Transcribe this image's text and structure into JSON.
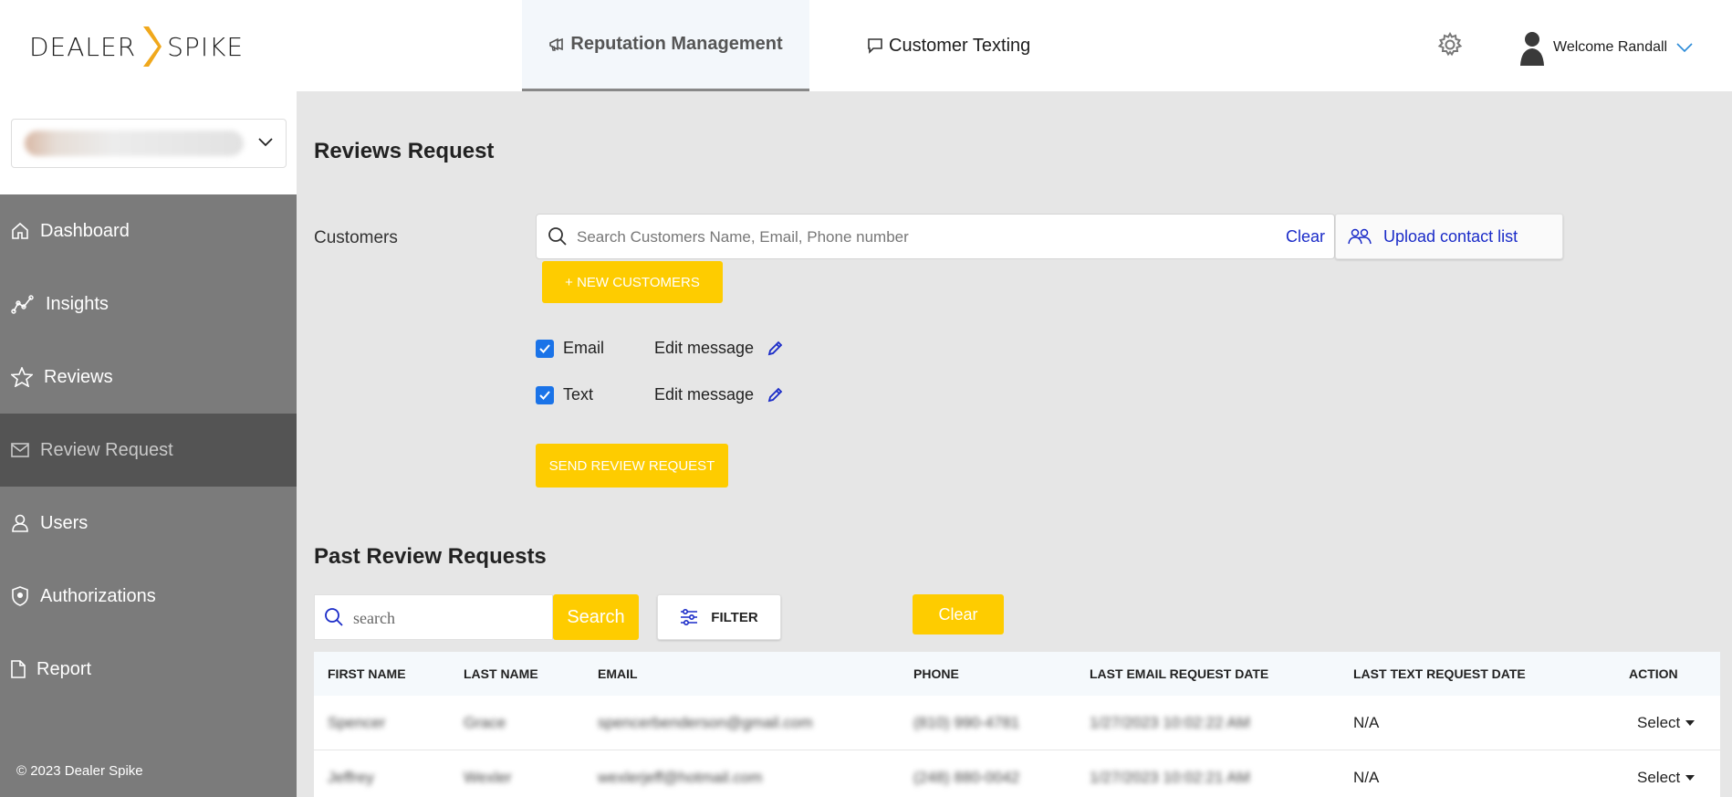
{
  "header": {
    "logo_left": "DEALER",
    "logo_right": "SPIKE",
    "tabs": [
      {
        "label": "Reputation Management",
        "icon": "megaphone-icon",
        "active": true
      },
      {
        "label": "Customer Texting",
        "icon": "chat-bubble-icon",
        "active": false
      }
    ],
    "welcome": "Welcome Randall"
  },
  "sidebar": {
    "items": [
      {
        "label": "Dashboard",
        "icon": "home-icon"
      },
      {
        "label": "Insights",
        "icon": "line-chart-icon"
      },
      {
        "label": "Reviews",
        "icon": "star-icon"
      },
      {
        "label": "Review Request",
        "icon": "envelope-icon",
        "active": true
      },
      {
        "label": "Users",
        "icon": "user-icon"
      },
      {
        "label": "Authorizations",
        "icon": "shield-icon"
      },
      {
        "label": "Report",
        "icon": "document-icon"
      }
    ],
    "copyright": "© 2023 Dealer Spike"
  },
  "main": {
    "title": "Reviews Request",
    "customers_label": "Customers",
    "search_placeholder": "Search Customers Name, Email, Phone number",
    "search_value": "",
    "search_clear": "Clear",
    "upload_label": "Upload contact list",
    "new_customers_label": "+ NEW CUSTOMERS",
    "options": [
      {
        "label": "Email",
        "checked": true,
        "edit_label": "Edit message"
      },
      {
        "label": "Text",
        "checked": true,
        "edit_label": "Edit message"
      }
    ],
    "send_label": "SEND REVIEW REQUEST"
  },
  "past": {
    "title": "Past Review Requests",
    "search_placeholder": "search",
    "search_button": "Search",
    "filter_label": "FILTER",
    "clear_label": "Clear",
    "columns": [
      "FIRST NAME",
      "LAST NAME",
      "EMAIL",
      "PHONE",
      "LAST EMAIL REQUEST DATE",
      "LAST TEXT REQUEST DATE",
      "ACTION"
    ],
    "rows": [
      {
        "first": "Spencer",
        "last": "Grace",
        "email": "spencerbenderson@gmail.com",
        "phone": "(810) 990-4781",
        "last_email": "1/27/2023 10:02:22 AM",
        "last_text": "N/A",
        "action": "Select"
      },
      {
        "first": "Jeffrey",
        "last": "Wexler",
        "email": "wexlerjeff@hotmail.com",
        "phone": "(248) 880-0042",
        "last_email": "1/27/2023 10:02:21 AM",
        "last_text": "N/A",
        "action": "Select"
      }
    ]
  },
  "colors": {
    "accent_yellow": "#fecc00",
    "link_blue": "#1a2bc8",
    "sidebar_gray": "#7b7b7b",
    "sidebar_active": "#545454",
    "checkbox_blue": "#1a73e8"
  }
}
